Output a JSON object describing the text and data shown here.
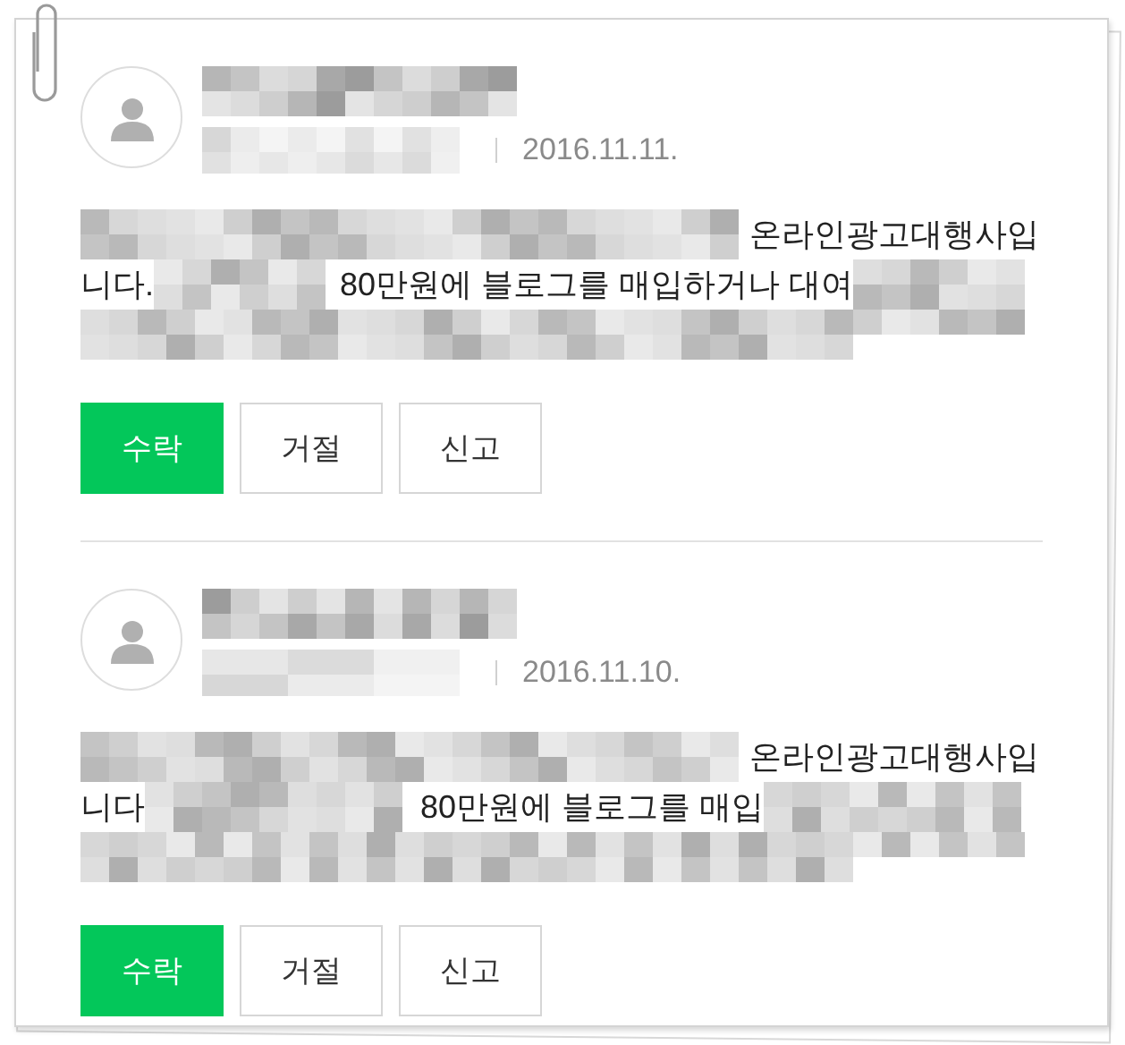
{
  "comments": [
    {
      "author": {
        "kind": "redacted"
      },
      "user_id": {
        "kind": "redacted"
      },
      "date": "2016.11.11.",
      "message_lines": [
        [
          {
            "kind": "redacted"
          },
          {
            "kind": "text",
            "text": "온라인광고대행사입"
          }
        ],
        [
          {
            "kind": "text",
            "text": "니다."
          },
          {
            "kind": "redacted"
          },
          {
            "kind": "text",
            "text": "80만원에 블로그를 매입하거나 대여"
          },
          {
            "kind": "redacted"
          }
        ],
        [
          {
            "kind": "redacted"
          }
        ]
      ],
      "buttons": [
        {
          "label": "수락",
          "kind": "primary"
        },
        {
          "label": "거절",
          "kind": "outline"
        },
        {
          "label": "신고",
          "kind": "outline"
        }
      ]
    },
    {
      "author": {
        "kind": "redacted"
      },
      "user_id": {
        "kind": "redacted"
      },
      "date": "2016.11.10.",
      "message_lines": [
        [
          {
            "kind": "redacted"
          },
          {
            "kind": "text",
            "text": "온라인광고대행사입"
          }
        ],
        [
          {
            "kind": "text",
            "text": "니다"
          },
          {
            "kind": "redacted"
          },
          {
            "kind": "text",
            "text": "80만원에 블로그를 매입"
          },
          {
            "kind": "redacted"
          }
        ],
        [
          {
            "kind": "redacted"
          }
        ]
      ],
      "buttons": [
        {
          "label": "수락",
          "kind": "primary"
        },
        {
          "label": "거절",
          "kind": "outline"
        },
        {
          "label": "신고",
          "kind": "outline"
        }
      ]
    }
  ]
}
